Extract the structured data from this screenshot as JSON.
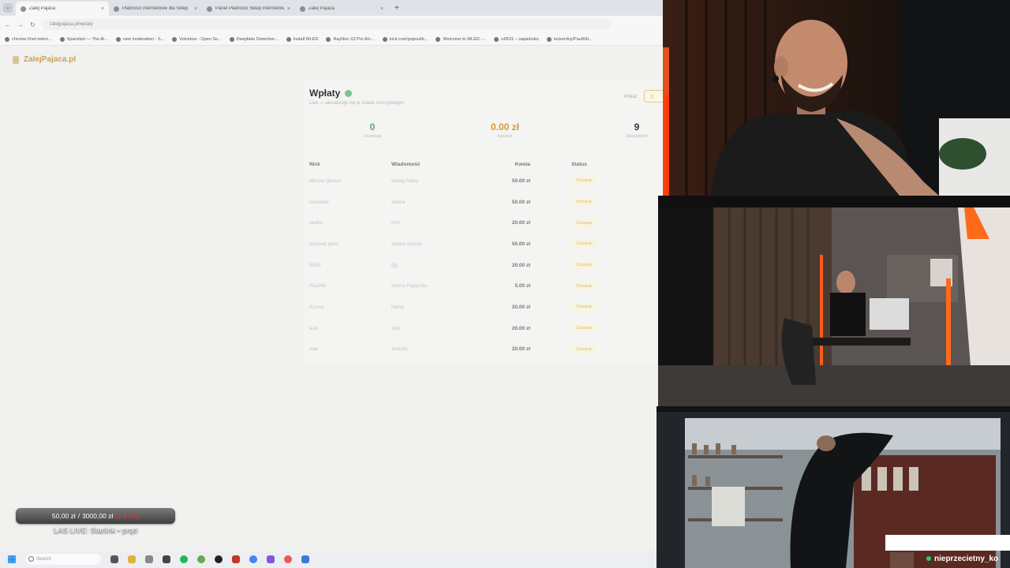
{
  "browser": {
    "tabs": [
      {
        "label": "Zalej Pajaca",
        "active": true
      },
      {
        "label": "Płatności internetowe dla Sklep",
        "active": false
      },
      {
        "label": "Panel Płatności Sklep Internetowy",
        "active": false
      },
      {
        "label": "Zalej Pajaca",
        "active": false
      }
    ],
    "close_glyph": "×",
    "new_tab_glyph": "+",
    "url": "zalejpajaca.pl/wplaty",
    "bookmarks": [
      "chrome://net-intern...",
      "Spacebot — The AI...",
      "new moderation - S...",
      "Voicebox - Open So...",
      "Deepfake Detection...",
      "Install WLED",
      "RayNeo X3 Pro AI+...",
      "kick.com/popout/k...",
      "Welcome to WLED -...",
      "cdf101 – saparkuko",
      "tuckerdriy/PaulKitt..."
    ]
  },
  "site": {
    "logo": "ZalejPajaca.pl",
    "title": "Wpłaty",
    "subtitle": "Live — aktualizuje się w czasie rzeczywistym",
    "filter_label": "Pokaż",
    "filter_button": "",
    "stats": [
      {
        "value": "0",
        "label": "Oczekuje",
        "color": "#5aa96a"
      },
      {
        "value": "0.00 zł",
        "label": "Łącznie",
        "color": "#d49a3a"
      },
      {
        "value": "9",
        "label": "Wszystkich",
        "color": "#333333"
      }
    ],
    "table": {
      "headers": [
        "Nick",
        "Wiadomość",
        "Kwota",
        "Status"
      ],
      "rows": [
        {
          "nick": "Mocne gówno",
          "msg": "dawaj hatsy",
          "amount": "50.00 zł",
          "status": "Oczekuje"
        },
        {
          "nick": "kowalski",
          "msg": "siema",
          "amount": "50.00 zł",
          "status": "Oczekuje"
        },
        {
          "nick": "pedro",
          "msg": "mm",
          "amount": "20.00 zł",
          "status": "Oczekuje"
        },
        {
          "nick": "testowy gosc",
          "msg": "siema mocne",
          "amount": "50.00 zł",
          "status": "Oczekuje"
        },
        {
          "nick": "5555",
          "msg": "tjtjj",
          "amount": "20.00 zł",
          "status": "Oczekuje"
        },
        {
          "nick": "PAJAM",
          "msg": "siema Pajączku",
          "amount": "5.00 zł",
          "status": "Oczekuje"
        },
        {
          "nick": "Kurwa",
          "msg": "Nana",
          "amount": "20.00 zł",
          "status": "Oczekuje"
        },
        {
          "nick": "asd",
          "msg": "asd",
          "amount": "20.00 zł",
          "status": "Oczekuje"
        },
        {
          "nick": "aaa",
          "msg": "asdsds",
          "amount": "20.00 zł",
          "status": "Oczekuje"
        }
      ]
    }
  },
  "overlay": {
    "goal_current": "50,00 zł",
    "goal_separator": "/",
    "goal_target": "3000,00 zł",
    "goal_percent": "(1.67%)",
    "goal_progress": 0.0167,
    "live_title": "LAS LIVE: Starlink • prqd",
    "viewer_name": "nieprzecietny_ko"
  },
  "taskbar": {
    "search_placeholder": "Search"
  },
  "colors": {
    "accent_gold": "#c9a15a",
    "goal_percent": "#e23b3b",
    "online": "#2ecc71"
  }
}
